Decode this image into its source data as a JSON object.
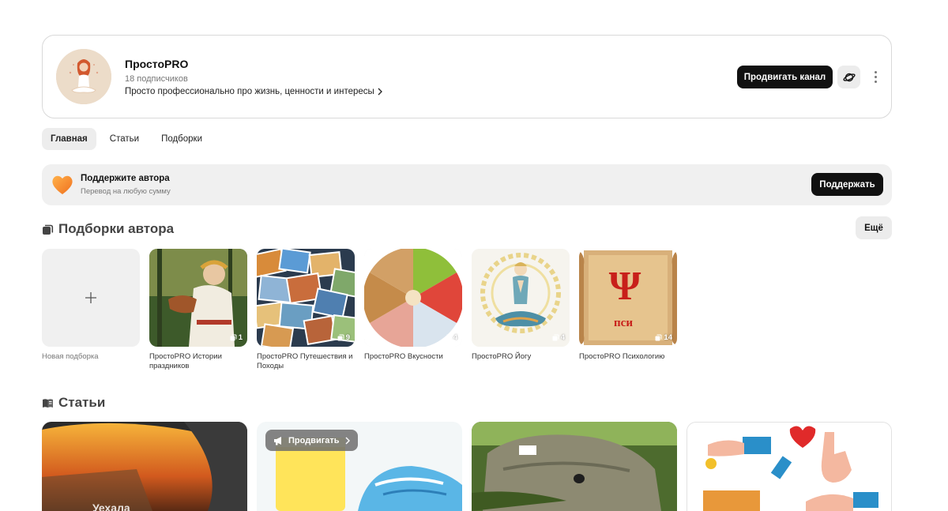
{
  "channel": {
    "name": "ПростоPRO",
    "subscribers": "18 подписчиков",
    "description": "Просто профессионально про жизнь, ценности и интересы",
    "promote_label": "Продвигать канал"
  },
  "tabs": [
    {
      "label": "Главная",
      "active": true
    },
    {
      "label": "Статьи",
      "active": false
    },
    {
      "label": "Подборки",
      "active": false
    }
  ],
  "support": {
    "title": "Поддержите автора",
    "subtitle": "Перевод на любую сумму",
    "button_label": "Поддержать"
  },
  "collections_section": {
    "title": "Подборки автора",
    "more_label": "Ещё",
    "new_label": "Новая подборка",
    "items": [
      {
        "label": "ПростоPRO Истории праздников",
        "count": "1",
        "theme": "#6b7d3a"
      },
      {
        "label": "ПростоPRO Путешествия и Походы",
        "count": "9",
        "theme": "#4a7fa8"
      },
      {
        "label": "ПростоPRO Вкусности",
        "count": "4",
        "theme": "#c9a15a"
      },
      {
        "label": "ПростоPRO Йогу",
        "count": "4",
        "theme": "#e9d48a"
      },
      {
        "label": "ПростоPRO Психологию",
        "count": "14",
        "theme": "#c8a272",
        "overlay_text": "пси"
      }
    ]
  },
  "articles_section": {
    "title": "Статьи",
    "items": [
      {
        "caption": "Уехала",
        "theme": "#a54a1a"
      },
      {
        "overlay": "Продвигать",
        "theme": "#e8f0f2"
      },
      {
        "theme": "#5b6b3a"
      },
      {
        "theme": "#ffffff"
      }
    ]
  },
  "colors": {
    "primary_button": "#111111",
    "soft_bg": "#f0f0f0",
    "heart": "#f28a2e"
  }
}
